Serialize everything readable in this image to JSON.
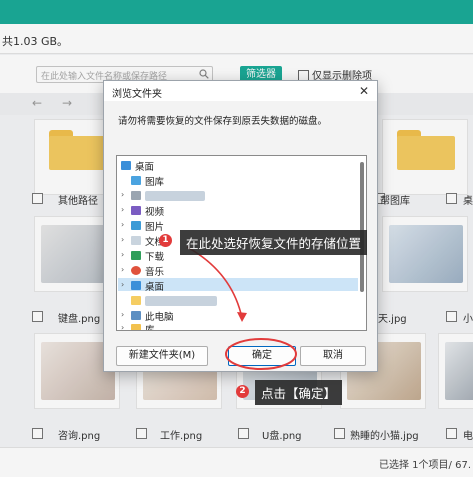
{
  "summary": {
    "text": "共1.03 GB。"
  },
  "filter": {
    "search_placeholder": "在此处输入文件名称或保存路径",
    "filter_button": "筛选器",
    "deleted_only_label": "仅显示删除项"
  },
  "nav": {
    "back_icon": "arrow-left-icon",
    "forward_icon": "arrow-right-icon"
  },
  "grid": {
    "rows": [
      [
        "",
        "其他路径",
        "",
        "",
        "帮图库",
        "桌"
      ],
      [
        "",
        "键盘.png",
        "",
        "",
        "天.jpg",
        "小"
      ],
      [
        "",
        "咨询.png",
        "工作.png",
        "U盘.png",
        "熟睡的小猫.jpg",
        "电"
      ]
    ]
  },
  "footer": {
    "selected_text": "已选择 1个项目/ 67."
  },
  "dialog": {
    "title": "浏览文件夹",
    "description": "请勿将需要恢复的文件保存到原丢失数据的磁盘。",
    "tree": [
      {
        "label": "桌面",
        "icon": "desktop-icon"
      },
      {
        "label": "图库",
        "icon": "gallery-icon"
      },
      {
        "label": "",
        "icon": "user-folder-icon"
      },
      {
        "label": "视频",
        "icon": "video-icon"
      },
      {
        "label": "图片",
        "icon": "pictures-icon"
      },
      {
        "label": "文档",
        "icon": "documents-icon"
      },
      {
        "label": "下载",
        "icon": "download-icon"
      },
      {
        "label": "音乐",
        "icon": "music-icon"
      },
      {
        "label": "桌面",
        "icon": "desktop-icon"
      },
      {
        "label": "",
        "icon": "folder-icon"
      },
      {
        "label": "此电脑",
        "icon": "computer-icon"
      },
      {
        "label": "库",
        "icon": "library-icon"
      }
    ],
    "new_folder_button": "新建文件夹(M)",
    "ok_button": "确定",
    "cancel_button": "取消",
    "close_icon": "close-icon"
  },
  "annotations": {
    "step1_badge": "1",
    "step1_text": "在此处选好恢复文件的存储位置",
    "step2_badge": "2",
    "step2_text": "点击【确定】"
  },
  "colors": {
    "accent": "#1bab98",
    "annotation_red": "#e23b3b",
    "folder": "#f5cd62"
  }
}
